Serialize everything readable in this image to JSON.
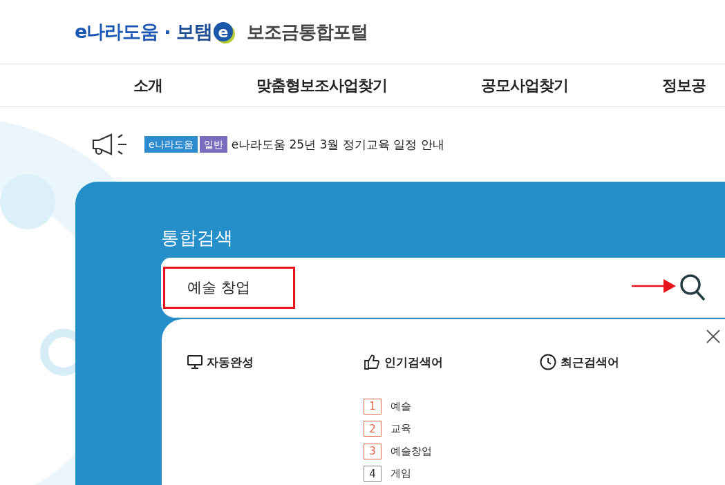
{
  "header": {
    "logo": {
      "part_1": "e나라도움",
      "separator": "·",
      "part_2": "보탬",
      "badge": "e"
    },
    "portal_name": "보조금통합포털"
  },
  "nav": {
    "items": [
      {
        "label": "소개"
      },
      {
        "label": "맞춤형보조사업찾기"
      },
      {
        "label": "공모사업찾기"
      },
      {
        "label": "정보공"
      }
    ]
  },
  "notice": {
    "tags": [
      {
        "label": "e나라도움",
        "color": "#2e8bd0"
      },
      {
        "label": "일반",
        "color": "#7b6dbd"
      }
    ],
    "text": "e나라도움 25년 3월 정기교육 일정 안내"
  },
  "search": {
    "title": "통합검색",
    "value": "예술 창업"
  },
  "dropdown": {
    "columns": [
      {
        "kind": "monitor",
        "heading": "자동완성"
      },
      {
        "kind": "thumb",
        "heading": "인기검색어",
        "items": [
          {
            "rank": "1",
            "term": "예술",
            "top": true
          },
          {
            "rank": "2",
            "term": "교육",
            "top": true
          },
          {
            "rank": "3",
            "term": "예술창업",
            "top": true
          },
          {
            "rank": "4",
            "term": "게임",
            "top": false
          }
        ]
      },
      {
        "kind": "clock",
        "heading": "최근검색어"
      }
    ]
  }
}
